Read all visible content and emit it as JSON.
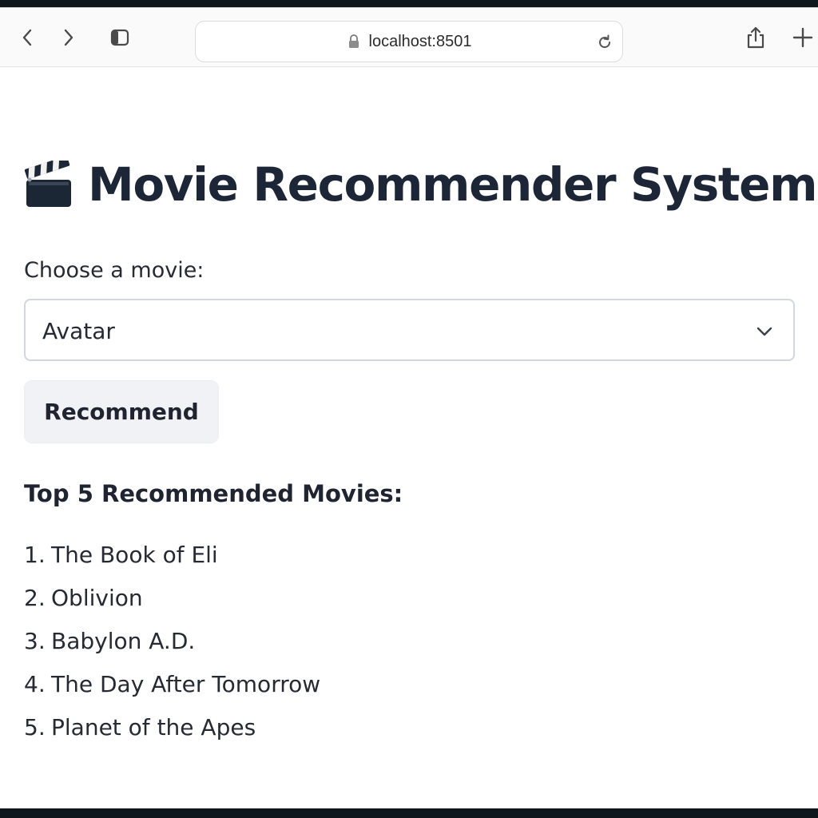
{
  "browser": {
    "url": "localhost:8501"
  },
  "app": {
    "title": "Movie Recommender System",
    "title_icon": "clapper-board-icon",
    "select": {
      "label": "Choose a movie:",
      "value": "Avatar"
    },
    "button_label": "Recommend",
    "results": {
      "heading": "Top 5 Recommended Movies:",
      "items": [
        {
          "number": "1.",
          "title": "The Book of Eli"
        },
        {
          "number": "2.",
          "title": "Oblivion"
        },
        {
          "number": "3.",
          "title": "Babylon A.D."
        },
        {
          "number": "4.",
          "title": "The Day After Tomorrow"
        },
        {
          "number": "5.",
          "title": "Planet of the Apes"
        }
      ]
    }
  },
  "colors": {
    "title_text": "#1d2636",
    "button_bg": "#f0f2f6",
    "select_border": "#d3d6dc"
  }
}
